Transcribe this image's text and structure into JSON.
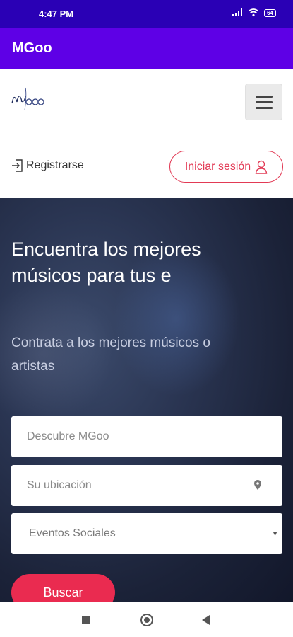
{
  "status_bar": {
    "time": "4:47 PM",
    "battery": "64"
  },
  "app_bar": {
    "title": "MGoo"
  },
  "header": {
    "logo_text": "MGoo",
    "register_label": "Registrarse",
    "login_label": "Iniciar sesión"
  },
  "hero": {
    "title": "Encuentra los mejores músicos para tus e",
    "subtitle": "Contrata a los mejores músicos o artistas",
    "search_placeholder": "Descubre MGoo",
    "location_placeholder": "Su ubicación",
    "category_selected": "Eventos Sociales",
    "search_button": "Buscar"
  },
  "colors": {
    "status_bar": "#2a00b5",
    "app_bar": "#5e00e6",
    "accent": "#ea2b50"
  },
  "icons": [
    "signal-icon",
    "wifi-icon",
    "battery-icon",
    "hamburger-menu-icon",
    "login-arrow-icon",
    "user-icon",
    "location-pin-icon",
    "dropdown-caret-icon"
  ]
}
